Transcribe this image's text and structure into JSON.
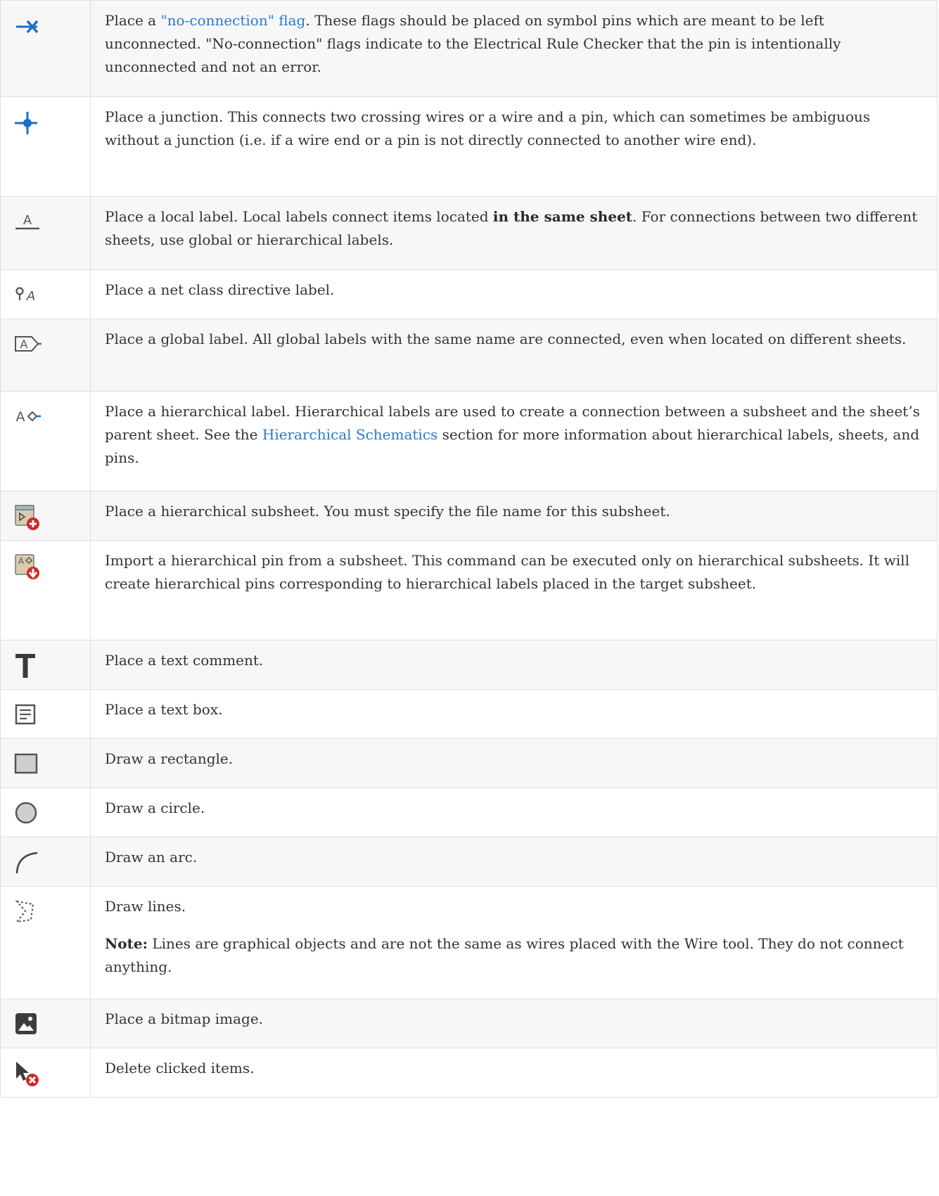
{
  "rows": [
    {
      "icon": "no-connection-flag-icon",
      "parts": [
        "Place a ",
        "\"no-connection\" flag",
        ". These flags should be placed on symbol pins which are meant to be left unconnected. \"No-connection\" flags indicate to the Electrical Rule Checker that the pin is intentionally unconnected and not an error."
      ]
    },
    {
      "icon": "junction-icon",
      "text": "Place a junction. This connects two crossing wires or a wire and a pin, which can sometimes be ambiguous without a junction (i.e. if a wire end or a pin is not directly connected to another wire end)."
    },
    {
      "icon": "local-label-icon",
      "parts": [
        "Place a local label. Local labels connect items located ",
        "in the same sheet",
        ". For connections between two different sheets, use global or hierarchical labels."
      ]
    },
    {
      "icon": "net-class-directive-icon",
      "text": "Place a net class directive label."
    },
    {
      "icon": "global-label-icon",
      "text": "Place a global label. All global labels with the same name are connected, even when located on different sheets."
    },
    {
      "icon": "hierarchical-label-icon",
      "parts": [
        "Place a hierarchical label. Hierarchical labels are used to create a connection between a subsheet and the sheet’s parent sheet. See the ",
        "Hierarchical Schematics",
        " section for more information about hierarchical labels, sheets, and pins."
      ]
    },
    {
      "icon": "hierarchical-subsheet-icon",
      "text": "Place a hierarchical subsheet. You must specify the file name for this subsheet."
    },
    {
      "icon": "import-hierarchical-pin-icon",
      "text": "Import a hierarchical pin from a subsheet. This command can be executed only on hierarchical subsheets. It will create hierarchical pins corresponding to hierarchical labels placed in the target subsheet."
    },
    {
      "icon": "text-comment-icon",
      "text": "Place a text comment."
    },
    {
      "icon": "text-box-icon",
      "text": "Place a text box."
    },
    {
      "icon": "rectangle-icon",
      "text": "Draw a rectangle."
    },
    {
      "icon": "circle-icon",
      "text": "Draw a circle."
    },
    {
      "icon": "arc-icon",
      "text": "Draw an arc."
    },
    {
      "icon": "lines-icon",
      "text": "Draw lines.",
      "note_label": "Note:",
      "note_text": " Lines are graphical objects and are not the same as wires placed with the Wire tool. They do not connect anything."
    },
    {
      "icon": "bitmap-image-icon",
      "text": "Place a bitmap image."
    },
    {
      "icon": "delete-items-icon",
      "text": "Delete clicked items."
    }
  ],
  "colors": {
    "link": "#2a79d1",
    "accent_blue": "#1a6fc4",
    "delete_red": "#cc2b2b",
    "row_shade": "#f7f7f8",
    "border": "#dedede"
  }
}
